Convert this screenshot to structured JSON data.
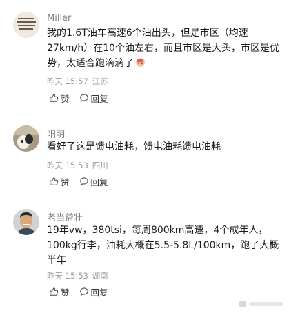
{
  "comments": [
    {
      "username": "Miller",
      "text": "我的1.6T油车高速6个油出头，但是市区（均速27km/h）在10个油左右，而且市区是大头，市区是优势，太适合跑滴滴了",
      "time": "昨天 15:57",
      "location": "江苏",
      "like_label": "赞",
      "reply_label": "回复"
    },
    {
      "username": "阳明",
      "text": "看好了这是馈电油耗，馈电油耗馈电油耗",
      "time": "昨天 15:53",
      "location": "四川",
      "like_label": "赞",
      "reply_label": "回复"
    },
    {
      "username": "老当益壮",
      "text": "19年vw，380tsi，每周800km高速，4个成年人，100kg行李，油耗大概在5.5-5.8L/100km，跑了大概半年",
      "time": "昨天 15:53",
      "location": "湖南",
      "like_label": "赞",
      "reply_label": "回复"
    }
  ],
  "icons": {
    "like": "thumbs-up-icon",
    "reply": "speech-bubble-icon",
    "emoji": "facepalm-emoji"
  }
}
